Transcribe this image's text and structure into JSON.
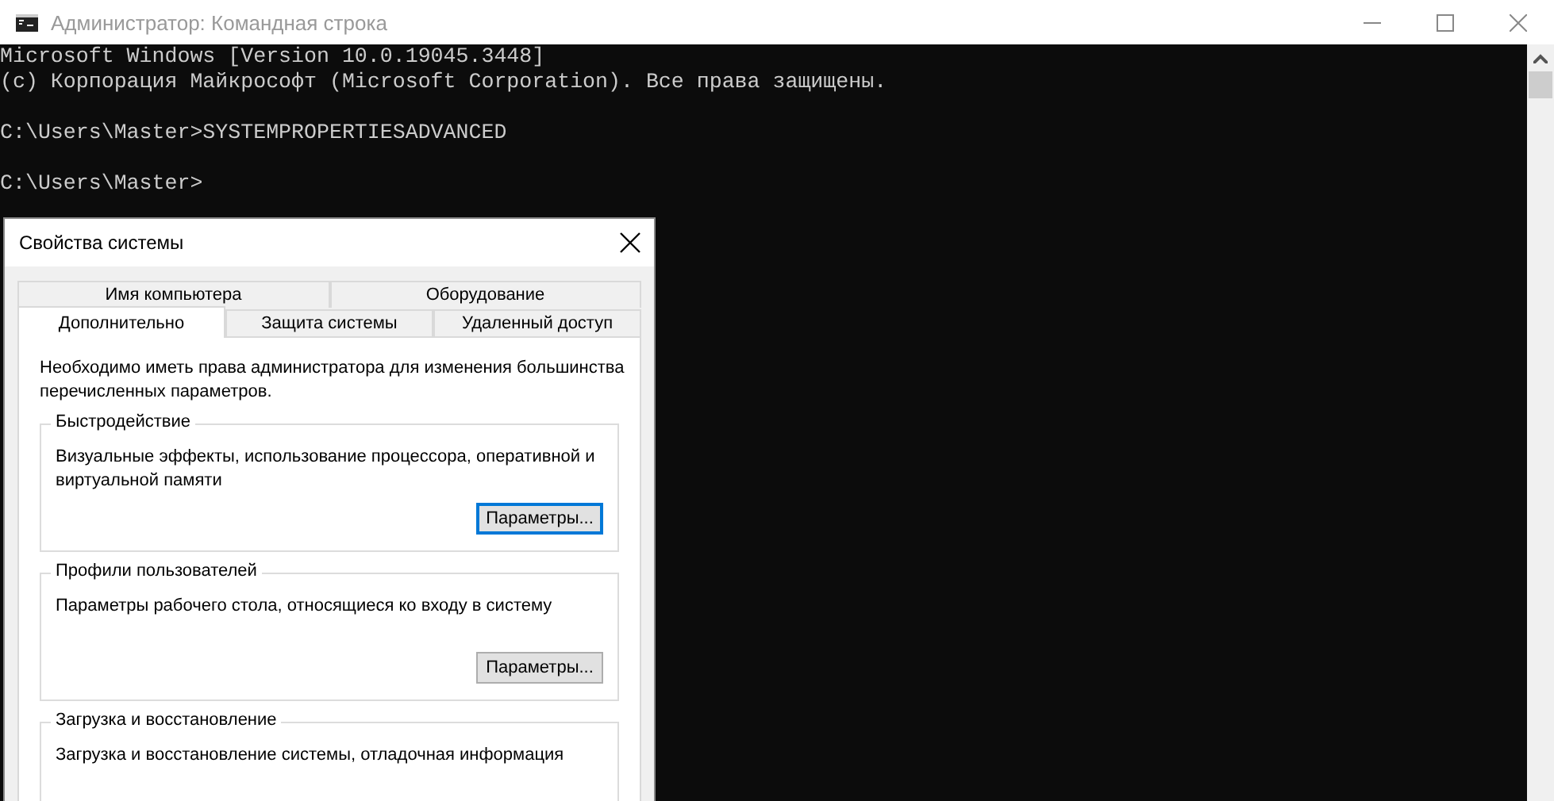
{
  "console": {
    "title": "Администратор: Командная строка",
    "blocks": [
      [
        "Microsoft Windows [Version 10.0.19045.3448]",
        "(c) Корпорация Майкрософт (Microsoft Corporation). Все права защищены."
      ],
      [
        "C:\\Users\\Master>SYSTEMPROPERTIESADVANCED"
      ],
      [
        "C:\\Users\\Master>"
      ]
    ]
  },
  "dialog": {
    "title": "Свойства системы",
    "tab_rows": [
      [
        {
          "label": "Имя компьютера",
          "selected": false
        },
        {
          "label": "Оборудование",
          "selected": false
        }
      ],
      [
        {
          "label": "Дополнительно",
          "selected": true
        },
        {
          "label": "Защита системы",
          "selected": false
        },
        {
          "label": "Удаленный доступ",
          "selected": false
        }
      ]
    ],
    "note": "Необходимо иметь права администратора для изменения большинства перечисленных параметров.",
    "groups": [
      {
        "title": "Быстродействие",
        "description": "Визуальные эффекты, использование процессора, оперативной и виртуальной памяти",
        "button": "Параметры...",
        "focused": true
      },
      {
        "title": "Профили пользователей",
        "description": "Параметры рабочего стола, относящиеся ко входу в систему",
        "button": "Параметры...",
        "focused": false
      },
      {
        "title": "Загрузка и восстановление",
        "description": "Загрузка и восстановление системы, отладочная информация"
      }
    ]
  }
}
